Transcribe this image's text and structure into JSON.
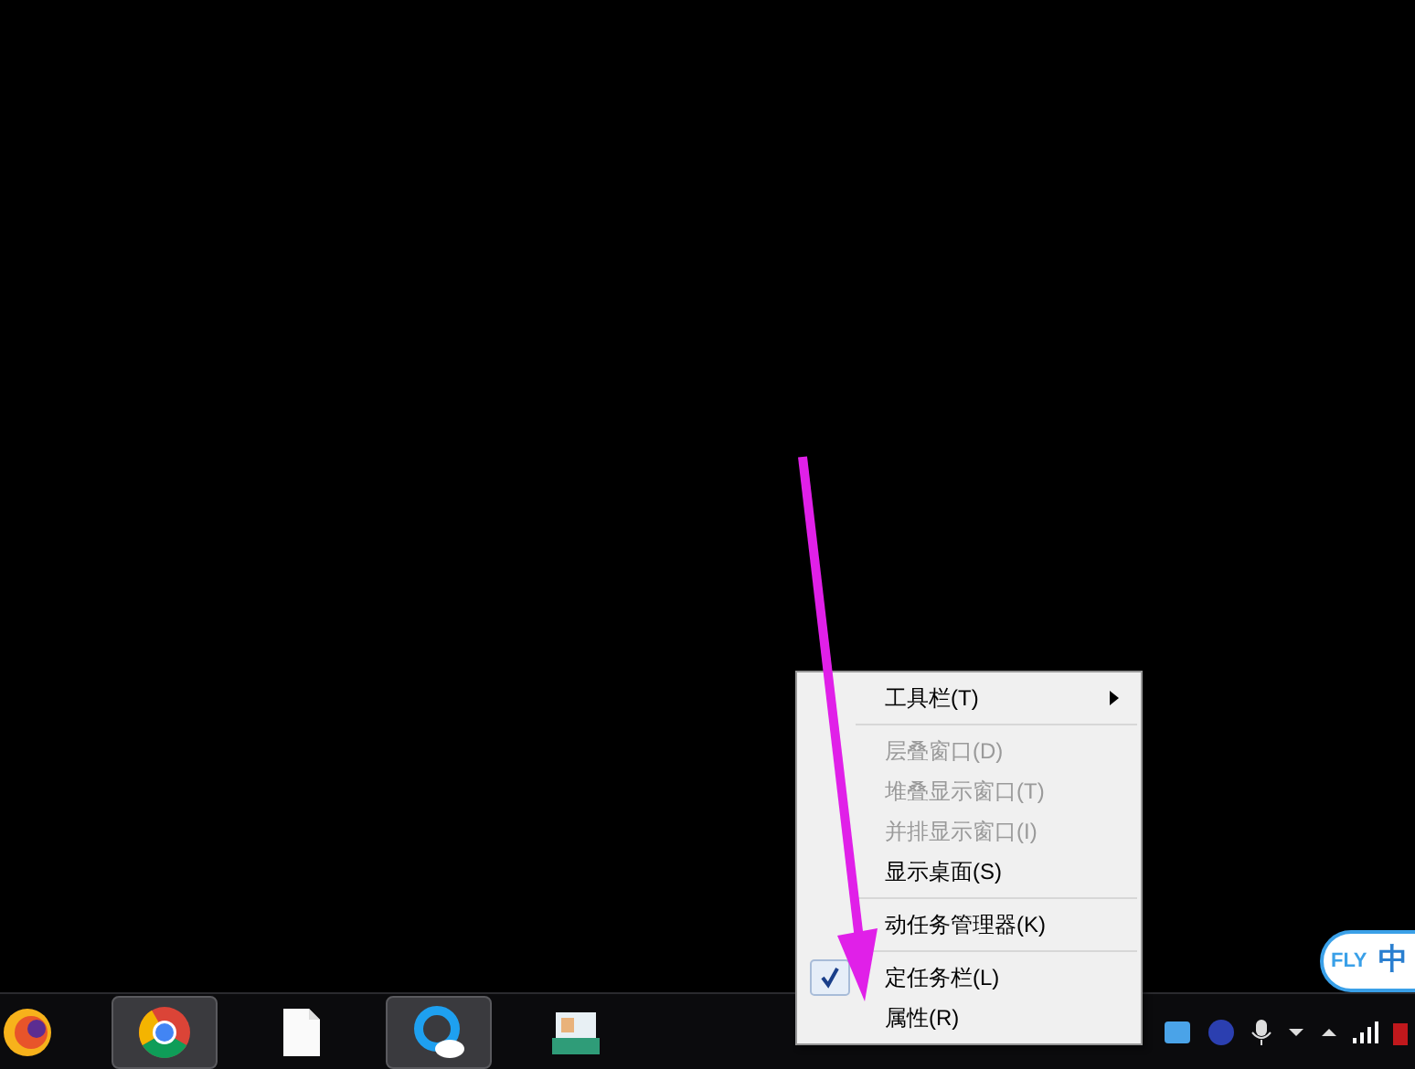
{
  "context_menu": {
    "groups": [
      [
        {
          "label": "工具栏(T)",
          "submenu": true,
          "disabled": false,
          "checked": false
        }
      ],
      [
        {
          "label": "层叠窗口(D)",
          "submenu": false,
          "disabled": true,
          "checked": false
        },
        {
          "label": "堆叠显示窗口(T)",
          "submenu": false,
          "disabled": true,
          "checked": false
        },
        {
          "label": "并排显示窗口(I)",
          "submenu": false,
          "disabled": true,
          "checked": false
        },
        {
          "label": "显示桌面(S)",
          "submenu": false,
          "disabled": false,
          "checked": false
        }
      ],
      [
        {
          "label": "动任务管理器(K)",
          "submenu": false,
          "disabled": false,
          "checked": false
        }
      ],
      [
        {
          "label": "定任务栏(L)",
          "submenu": false,
          "disabled": false,
          "checked": true
        },
        {
          "label": "属性(R)",
          "submenu": false,
          "disabled": false,
          "checked": false
        }
      ]
    ]
  },
  "taskbar": {
    "apps": [
      {
        "kind": "firefox",
        "selected": false
      },
      {
        "kind": "chrome",
        "selected": true
      },
      {
        "kind": "file",
        "selected": false
      },
      {
        "kind": "cloud",
        "selected": true
      },
      {
        "kind": "contacts",
        "selected": false
      }
    ]
  },
  "ime": {
    "brand": "FLY",
    "mode": "中"
  }
}
